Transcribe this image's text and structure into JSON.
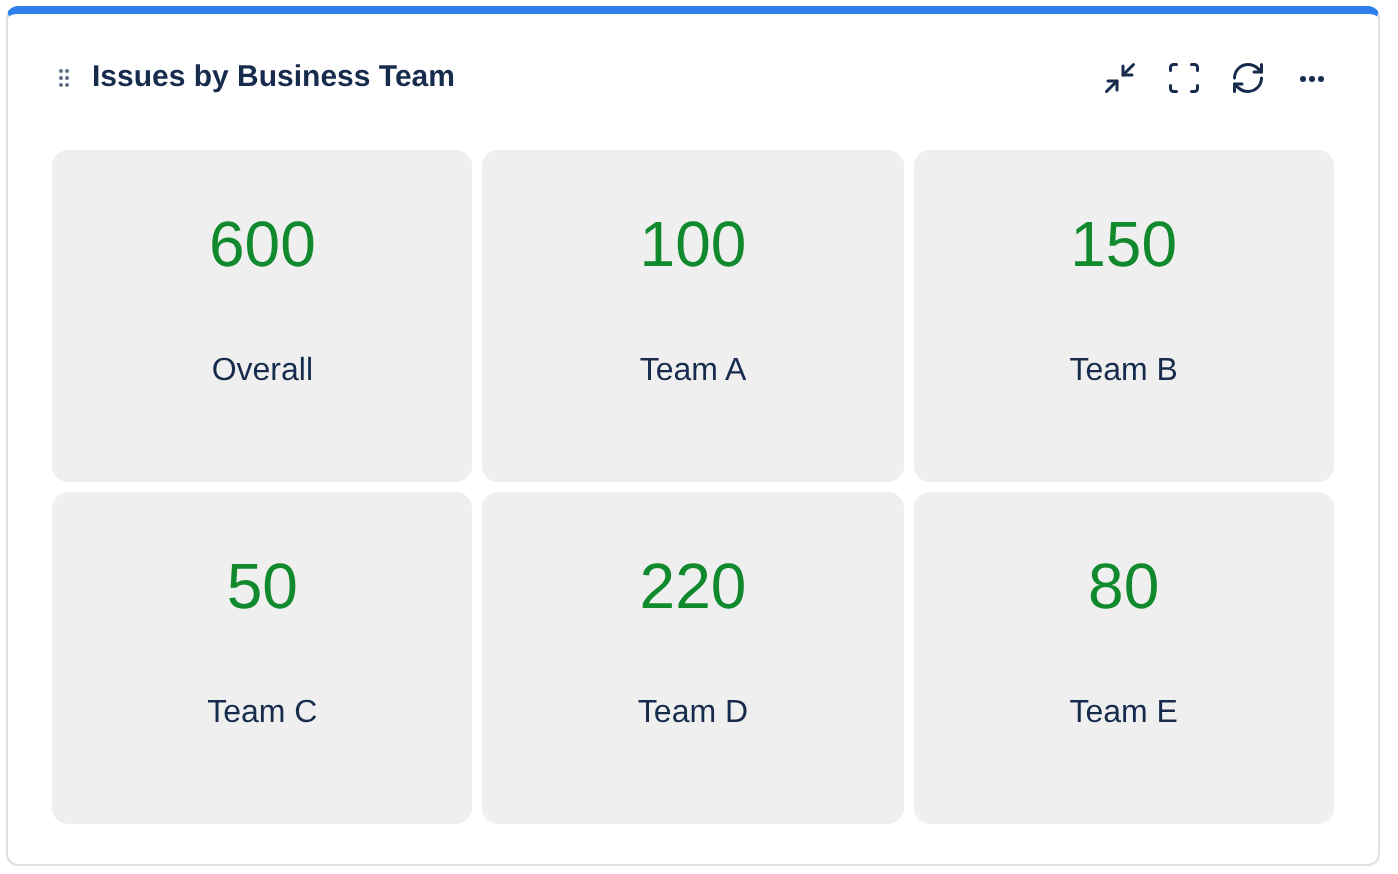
{
  "widget": {
    "title": "Issues by Business Team"
  },
  "tiles": [
    {
      "value": "600",
      "label": "Overall"
    },
    {
      "value": "100",
      "label": "Team A"
    },
    {
      "value": "150",
      "label": "Team B"
    },
    {
      "value": "50",
      "label": "Team C"
    },
    {
      "value": "220",
      "label": "Team D"
    },
    {
      "value": "80",
      "label": "Team E"
    }
  ]
}
